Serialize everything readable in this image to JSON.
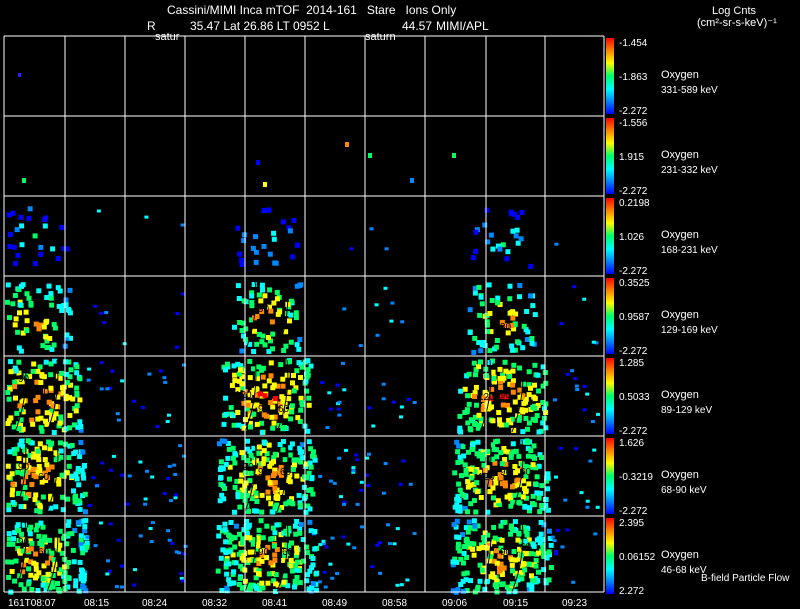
{
  "header": {
    "title": "Cassini/MIMI Inca mTOF  2014-161   Stare   Ions Only",
    "r_label": "R",
    "position_line": "35.47 Lat 26.86 LT 0952 L",
    "l_value": "44.57",
    "credit": "MIMI/APL",
    "saturn_label_1": "satur",
    "saturn_label_2": "saturn",
    "units_line1": "Log Cnts",
    "units_line2": "(cm²-sr-s-keV)⁻¹"
  },
  "footer": {
    "time_labels": [
      "161T08:07",
      "08:15",
      "08:24",
      "08:32",
      "08:41",
      "08:49",
      "08:58",
      "09:06",
      "09:15",
      "09:23"
    ],
    "flow_label": "B-field Particle Flow"
  },
  "chart_data": {
    "type": "heatmap",
    "species": "Oxygen",
    "x_tick_labels": [
      "161T08:07",
      "08:15",
      "08:24",
      "08:32",
      "08:41",
      "08:49",
      "08:58",
      "09:06",
      "09:15",
      "09:23"
    ],
    "panels": [
      {
        "species": "Oxygen",
        "energy": "331-589 keV",
        "cbar": [
          "-1.454",
          "-1.863",
          "-2.272"
        ]
      },
      {
        "species": "Oxygen",
        "energy": "231-332 keV",
        "cbar": [
          "-1.556",
          "1.915",
          "-2.272"
        ]
      },
      {
        "species": "Oxygen",
        "energy": "168-231 keV",
        "cbar": [
          "0.2198",
          "1.026",
          "-2.272"
        ]
      },
      {
        "species": "Oxygen",
        "energy": "129-169 keV",
        "cbar": [
          "0.3525",
          "0.9587",
          "-2.272"
        ]
      },
      {
        "species": "Oxygen",
        "energy": "89-129 keV",
        "cbar": [
          "1.285",
          "0.5033",
          "-2.272"
        ]
      },
      {
        "species": "Oxygen",
        "energy": "68-90 keV",
        "cbar": [
          "1.626",
          "-0.3219",
          "-2.272"
        ]
      },
      {
        "species": "Oxygen",
        "energy": "46-68 keV",
        "cbar": [
          "2.395",
          "0.06152",
          "2.272"
        ]
      }
    ],
    "contour_labels": [
      "90",
      "60",
      "120",
      "30"
    ],
    "colorbar_colors": [
      "#ff0000",
      "#ff8800",
      "#ffff00",
      "#00ff66",
      "#00ffff",
      "#0088ff",
      "#0000ff"
    ]
  }
}
